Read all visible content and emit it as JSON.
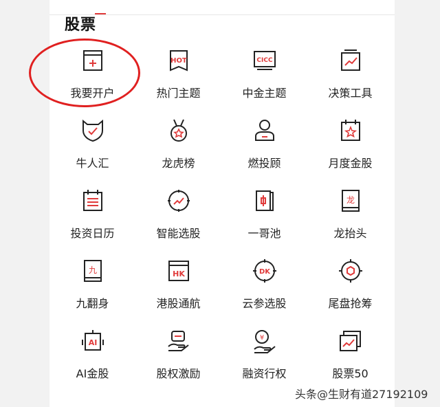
{
  "section": {
    "title": "股票"
  },
  "watermark": "头条@生财有道27192109",
  "colors": {
    "accent": "#e03a3a",
    "icon_stroke": "#222222",
    "highlight_circle": "#e02020"
  },
  "items": [
    [
      {
        "label": "我要开户",
        "icon": "account-open-icon"
      },
      {
        "label": "热门主题",
        "icon": "hot-icon",
        "icon_text": "HOT"
      },
      {
        "label": "中金主题",
        "icon": "cicc-icon",
        "icon_text": "CICC"
      },
      {
        "label": "决策工具",
        "icon": "decision-chart-icon"
      }
    ],
    [
      {
        "label": "牛人汇",
        "icon": "bull-shield-icon"
      },
      {
        "label": "龙虎榜",
        "icon": "medal-star-icon"
      },
      {
        "label": "燃投顾",
        "icon": "advisor-person-icon"
      },
      {
        "label": "月度金股",
        "icon": "calendar-star-icon"
      }
    ],
    [
      {
        "label": "投资日历",
        "icon": "calendar-list-icon"
      },
      {
        "label": "智能选股",
        "icon": "smart-compass-icon"
      },
      {
        "label": "一哥池",
        "icon": "book-candle-icon"
      },
      {
        "label": "龙抬头",
        "icon": "dragon-book-icon",
        "icon_text": "龙"
      }
    ],
    [
      {
        "label": "九翻身",
        "icon": "nine-book-icon",
        "icon_text": "九"
      },
      {
        "label": "港股通航",
        "icon": "hk-icon",
        "icon_text": "HK"
      },
      {
        "label": "云参选股",
        "icon": "dk-target-icon",
        "icon_text": "DK"
      },
      {
        "label": "尾盘抢筹",
        "icon": "target-hexagon-icon"
      }
    ],
    [
      {
        "label": "AI金股",
        "icon": "ai-robot-icon",
        "icon_text": "AI"
      },
      {
        "label": "股权激励",
        "icon": "hand-equity-icon"
      },
      {
        "label": "融资行权",
        "icon": "hand-coin-icon",
        "icon_text": "¥"
      },
      {
        "label": "股票50",
        "icon": "stock50-cards-icon"
      }
    ]
  ]
}
